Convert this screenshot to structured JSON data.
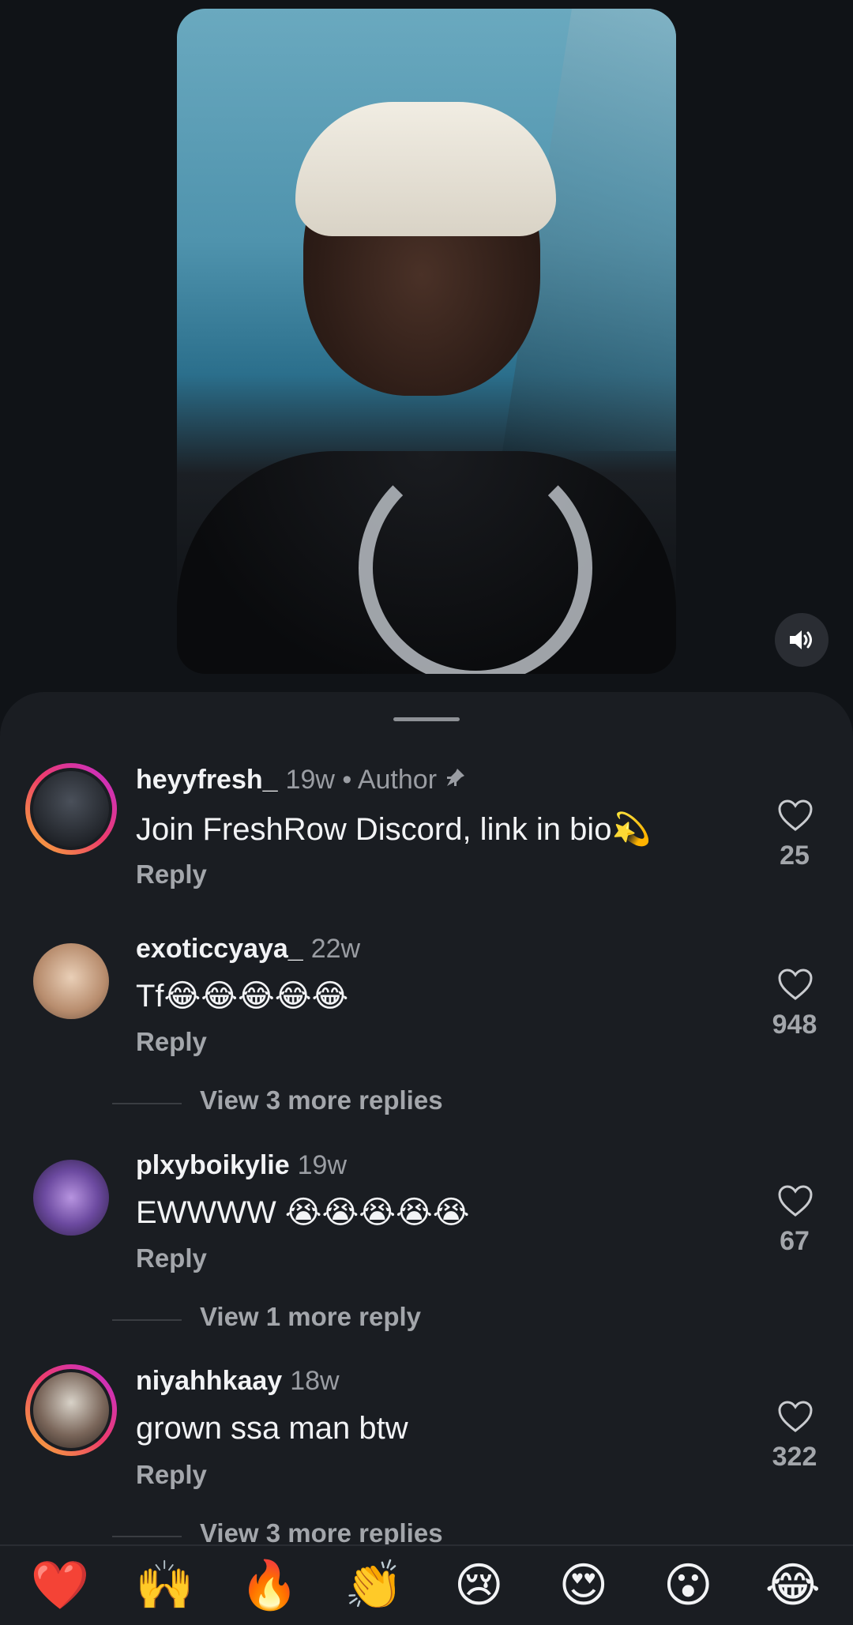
{
  "video": {
    "sound_icon": "speaker-on-icon"
  },
  "comments": [
    {
      "username": "heyyfresh_",
      "meta": "19w • Author",
      "pinned": true,
      "text": "Join FreshRow Discord, link in bio💫",
      "reply_label": "Reply",
      "likes": "25",
      "avatar_ring": true,
      "avatar_colors": [
        "#3a3f47",
        "#1c1f24"
      ]
    },
    {
      "username": "exoticcyaya_",
      "meta": "22w",
      "text": "Tf😂😂😂😂😂",
      "reply_label": "Reply",
      "likes": "948",
      "avatar_ring": false,
      "avatar_colors": [
        "#e8c9b0",
        "#b38a6a"
      ],
      "view_more": "View 3 more replies"
    },
    {
      "username": "plxyboikylie",
      "meta": "19w",
      "text": "EWWWW 😭😭😭😭😭",
      "reply_label": "Reply",
      "likes": "67",
      "avatar_ring": false,
      "avatar_colors": [
        "#8a66c9",
        "#3a2a5a"
      ],
      "view_more": "View 1 more reply"
    },
    {
      "username": "niyahhkaay",
      "meta": "18w",
      "text": "grown ssa man btw",
      "reply_label": "Reply",
      "likes": "322",
      "avatar_ring": true,
      "avatar_colors": [
        "#d9d4cc",
        "#5a4a42"
      ],
      "view_more": "View 3 more replies"
    }
  ],
  "emoji_bar": [
    "❤️",
    "🙌",
    "🔥",
    "👏",
    "😢",
    "😍",
    "😮",
    "😂"
  ],
  "colors": {
    "background": "#101317",
    "sheet": "#1a1d22",
    "secondary_text": "#a3a6ab",
    "ring_gradient": [
      "#f7b733",
      "#ee3d6a",
      "#c22bd6"
    ]
  }
}
